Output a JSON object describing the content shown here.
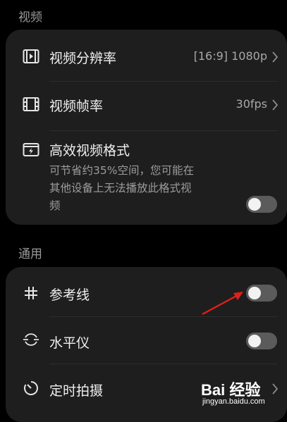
{
  "sections": {
    "video": "视频",
    "general": "通用"
  },
  "video": {
    "resolution": {
      "label": "视频分辨率",
      "value": "[16:9] 1080p"
    },
    "framerate": {
      "label": "视频帧率",
      "value": "30fps"
    },
    "efficient": {
      "label": "高效视频格式",
      "desc_line1": "可节省约35%空间，您可能在",
      "desc_line2": "其他设备上无法播放此格式视",
      "desc_line3": "频",
      "enabled": false
    }
  },
  "general": {
    "grid": {
      "label": "参考线",
      "enabled": false
    },
    "level": {
      "label": "水平仪",
      "enabled": false
    },
    "timer": {
      "label": "定时拍摄"
    }
  },
  "watermark": {
    "main": "Bai 经验",
    "sub": "jingyan.baidu.com"
  },
  "colors": {
    "background": "#000000",
    "card": "#1e1e1e",
    "toggle_off": "#5b5b5b",
    "arrow": "#e0201b"
  }
}
